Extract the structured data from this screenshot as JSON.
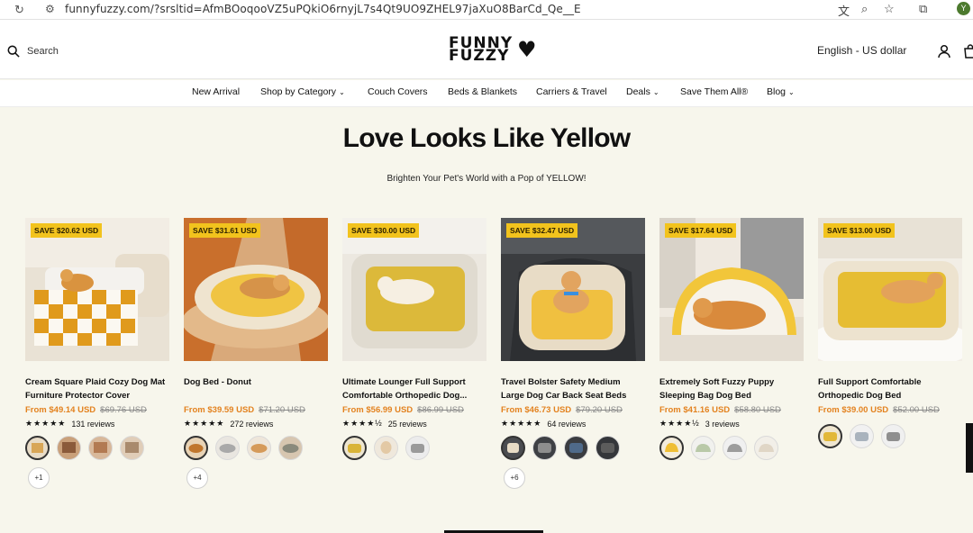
{
  "browser": {
    "url": "funnyfuzzy.com/?srsltid=AfmBOoqooVZ5uPQkiO6rnyjL7s4Qt9UO9ZHEL97jaXuO8BarCd_Qe__E",
    "profile_initial": "Y"
  },
  "header": {
    "search_label": "Search",
    "logo_line1": "FUNNY",
    "logo_line2": "FUZZY",
    "language_currency": "English - US dollar"
  },
  "nav": {
    "items": [
      {
        "label": "New Arrival",
        "has_dropdown": false
      },
      {
        "label": "Shop by Category",
        "has_dropdown": true
      },
      {
        "label": "Couch Covers",
        "has_dropdown": false
      },
      {
        "label": "Beds & Blankets",
        "has_dropdown": false
      },
      {
        "label": "Carriers & Travel",
        "has_dropdown": false
      },
      {
        "label": "Deals",
        "has_dropdown": true
      },
      {
        "label": "Save Them All®",
        "has_dropdown": false
      },
      {
        "label": "Blog",
        "has_dropdown": true
      }
    ]
  },
  "section": {
    "title": "Love Looks Like Yellow",
    "subtitle": "Brighten Your Pet's World with a Pop of YELLOW!"
  },
  "products": [
    {
      "badge": "SAVE $20.62 USD",
      "title": "Cream Square Plaid Cozy Dog Mat Furniture Protector Cover",
      "price": "From $49.14 USD",
      "was": "$69.76 USD",
      "stars": "★★★★★",
      "reviews": "131 reviews",
      "more": "+1"
    },
    {
      "badge": "SAVE $31.61 USD",
      "title": "Dog Bed - Donut",
      "price": "From $39.59 USD",
      "was": "$71.20 USD",
      "stars": "★★★★★",
      "reviews": "272 reviews",
      "more": "+4"
    },
    {
      "badge": "SAVE $30.00 USD",
      "title": "Ultimate Lounger Full Support Comfortable Orthopedic Dog...",
      "price": "From $56.99 USD",
      "was": "$86.99 USD",
      "stars": "★★★★½",
      "reviews": "25 reviews",
      "more": ""
    },
    {
      "badge": "SAVE $32.47 USD",
      "title": "Travel Bolster Safety Medium Large Dog Car Back Seat Beds",
      "price": "From $46.73 USD",
      "was": "$79.20 USD",
      "stars": "★★★★★",
      "reviews": "64 reviews",
      "more": "+6"
    },
    {
      "badge": "SAVE $17.64 USD",
      "title": "Extremely Soft Fuzzy Puppy Sleeping Bag Dog Bed",
      "price": "From $41.16 USD",
      "was": "$58.80 USD",
      "stars": "★★★★½",
      "reviews": "3 reviews",
      "more": ""
    },
    {
      "badge": "SAVE $13.00 USD",
      "title": "Full Support Comfortable Orthopedic Dog Bed",
      "price": "From $39.00 USD",
      "was": "$52.00 USD",
      "stars": "",
      "reviews": "",
      "more": ""
    }
  ],
  "colors": {
    "accent_price": "#e3821f",
    "badge_bg": "#f2c31d",
    "page_bg": "#f7f6ec"
  }
}
